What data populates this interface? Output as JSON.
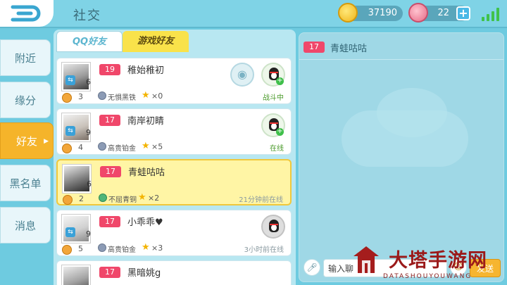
{
  "header": {
    "title": "社交",
    "back_icon": "back-arrow-icon",
    "coins": "37190",
    "shells": "22",
    "plus": "+"
  },
  "sidebar": {
    "items": [
      {
        "label": "附近"
      },
      {
        "label": "缘分"
      },
      {
        "label": "好友",
        "active": true
      },
      {
        "label": "黑名单"
      },
      {
        "label": "消息"
      }
    ]
  },
  "tabs": {
    "qq": "QQ好友",
    "game": "游戏好友"
  },
  "friends": [
    {
      "age": "19",
      "name": "稚始稚初",
      "avatar_count": "6",
      "level": "3",
      "rank": "无惧黑铁",
      "stars": "×0",
      "status": "战斗中",
      "status_color": "#4a9a2a"
    },
    {
      "age": "17",
      "name": "南岸初睛",
      "avatar_count": "9",
      "level": "4",
      "rank": "高贵铂金",
      "stars": "×5",
      "status": "在线",
      "status_color": "#4a9a2a"
    },
    {
      "age": "17",
      "name": "青蛙咕咕",
      "avatar_count": "6",
      "level": "2",
      "rank": "不屈青铜",
      "stars": "×2",
      "status": "21分钟前在线",
      "status_color": "#8a9aa0",
      "selected": true
    },
    {
      "age": "17",
      "name": "小乖乖♥",
      "avatar_count": "9",
      "level": "5",
      "rank": "高贵铂金",
      "stars": "×3",
      "status": "3小时前在线",
      "status_color": "#8a9aa0"
    },
    {
      "age": "17",
      "name": "黑暗姚g",
      "avatar_count": "",
      "level": "",
      "rank": "",
      "stars": "",
      "status": ""
    }
  ],
  "chat": {
    "age": "17",
    "name": "青蛙咕咕",
    "input_value": "输入聊",
    "send_label": "发送"
  },
  "watermark": {
    "main": "大塔手游网",
    "sub": "DATASHOUYOUWANG"
  },
  "colors": {
    "accent": "#f5b42a",
    "age_badge": "#f0476a",
    "online": "#4a9a2a"
  }
}
